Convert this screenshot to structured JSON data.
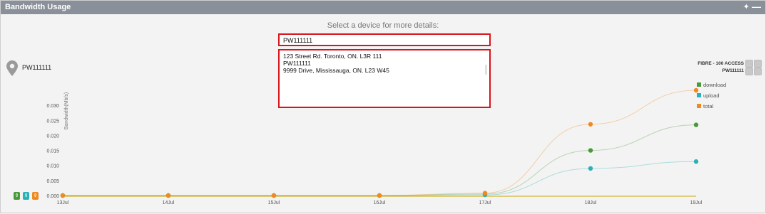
{
  "window": {
    "title": "Bandwidth Usage"
  },
  "selector": {
    "prompt": "Select a device for more details:",
    "input_value": "PW111111",
    "options": [
      "123 Street Rd. Toronto, ON. L3R 111",
      "PW111111",
      "9999 Drive, Mississauga, ON. L23 W45"
    ]
  },
  "device": {
    "name": "PW111111"
  },
  "access": {
    "label": "FIBRE - 100 ACCESS",
    "device": "PW111111"
  },
  "legend": [
    {
      "label": "download",
      "color": "#4a9a3a"
    },
    {
      "label": "upload",
      "color": "#2ab1b7"
    },
    {
      "label": "total",
      "color": "#f08a1e"
    }
  ],
  "chart_data": {
    "type": "line",
    "ylabel": "Bandwidth(Mb/s)",
    "xlabel": "",
    "categories": [
      "13Jul",
      "14Jul",
      "15Jul",
      "16Jul",
      "17Jul",
      "18Jul",
      "19Jul"
    ],
    "y_ticks": [
      "0.000",
      "0.005",
      "0.010",
      "0.015",
      "0.020",
      "0.025",
      "0.030"
    ],
    "ylim": [
      0,
      0.035
    ],
    "grid": false,
    "legend_position": "right",
    "series": [
      {
        "name": "download",
        "color": "#4a9a3a",
        "values": [
          0,
          0,
          0,
          0,
          0.0005,
          0.015,
          0.0235
        ]
      },
      {
        "name": "upload",
        "color": "#2ab1b7",
        "values": [
          0,
          0,
          0,
          0,
          0.0002,
          0.009,
          0.0113
        ]
      },
      {
        "name": "total",
        "color": "#f08a1e",
        "values": [
          0,
          0,
          0,
          0,
          0.0008,
          0.0237,
          0.035
        ]
      }
    ]
  },
  "zoom_controls": [
    {
      "icon": "arrow-up-down-icon",
      "color": "#4a9a3a"
    },
    {
      "icon": "arrow-up-down-icon",
      "color": "#2ab1b7"
    },
    {
      "icon": "arrow-up-down-icon",
      "color": "#f08a1e"
    }
  ]
}
